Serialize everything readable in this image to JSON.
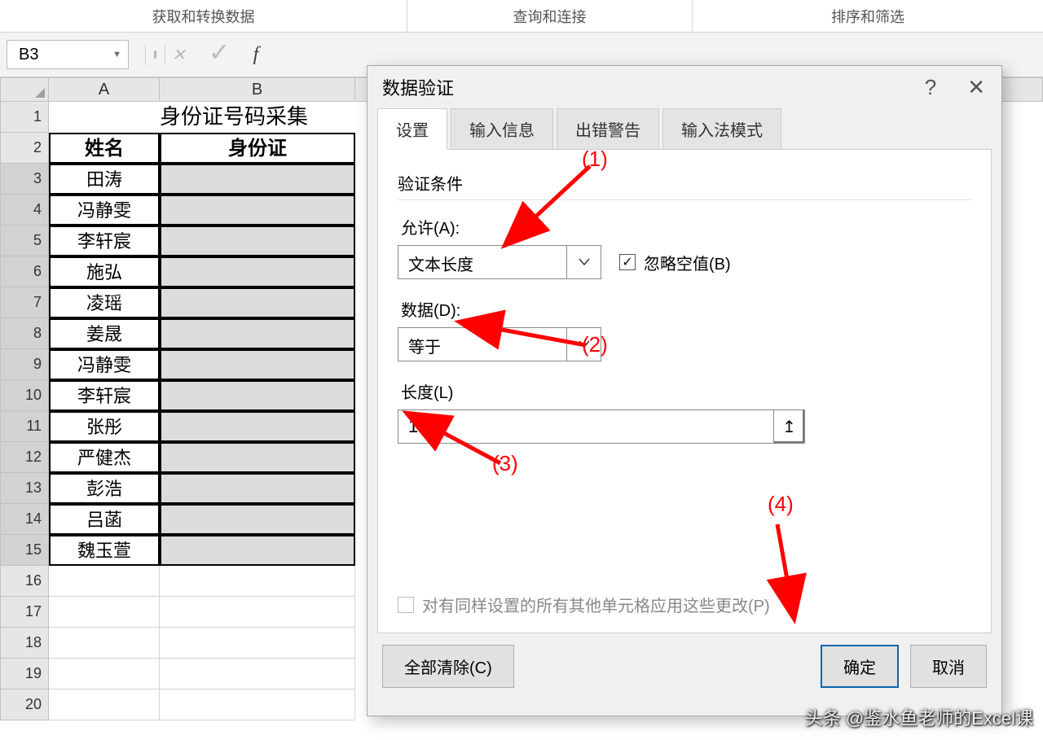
{
  "ribbon": {
    "group1": "获取和转换数据",
    "group2": "查询和连接",
    "group3": "排序和筛选"
  },
  "formula": {
    "cellref": "B3"
  },
  "grid": {
    "colA": "A",
    "colB": "B",
    "title": "身份证号码采集",
    "hdrA": "姓名",
    "hdrB": "身份证",
    "names": [
      "田涛",
      "冯静雯",
      "李轩宸",
      "施弘",
      "凌瑶",
      "姜晟",
      "冯静雯",
      "李轩宸",
      "张彤",
      "严健杰",
      "彭浩",
      "吕菡",
      "魏玉萱"
    ],
    "rows_after": [
      "16",
      "17",
      "18",
      "19",
      "20"
    ]
  },
  "dialog": {
    "title": "数据验证",
    "help": "?",
    "close": "✕",
    "tabs": {
      "settings": "设置",
      "inputmsg": "输入信息",
      "error": "出错警告",
      "ime": "输入法模式"
    },
    "section": "验证条件",
    "allow_lbl": "允许(A):",
    "allow_val": "文本长度",
    "ignore_blank": "忽略空值(B)",
    "data_lbl": "数据(D):",
    "data_val": "等于",
    "length_lbl": "长度(L)",
    "length_val": "18",
    "apply_all": "对有同样设置的所有其他单元格应用这些更改(P)",
    "clear": "全部清除(C)",
    "ok": "确定",
    "cancel": "取消"
  },
  "annotations": {
    "a1": "(1)",
    "a2": "(2)",
    "a3": "(3)",
    "a4": "(4)"
  },
  "watermark": "头条 @鉴水鱼老师的Excel课"
}
